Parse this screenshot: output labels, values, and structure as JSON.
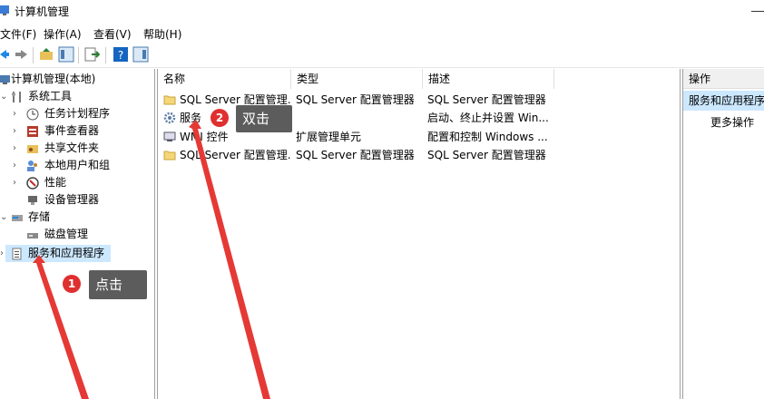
{
  "window": {
    "title": "计算机管理"
  },
  "menu": {
    "file": "文件(F)",
    "action": "操作(A)",
    "view": "查看(V)",
    "help": "帮助(H)"
  },
  "tree": {
    "root": "计算机管理(本地)",
    "system_tools": "系统工具",
    "task_scheduler": "任务计划程序",
    "event_viewer": "事件查看器",
    "shared_folders": "共享文件夹",
    "local_users": "本地用户和组",
    "performance": "性能",
    "device_manager": "设备管理器",
    "storage": "存储",
    "disk_management": "磁盘管理",
    "services_apps": "服务和应用程序"
  },
  "list": {
    "columns": {
      "name": "名称",
      "type": "类型",
      "desc": "描述"
    },
    "rows": [
      {
        "name": "SQL Server 配置管理...",
        "type": "SQL Server 配置管理器",
        "desc": "SQL Server 配置管理器"
      },
      {
        "name": "服务",
        "type": "",
        "desc": "启动、终止并设置 Win..."
      },
      {
        "name": "WMI 控件",
        "type": "扩展管理单元",
        "desc": "配置和控制 Windows ..."
      },
      {
        "name": "SQL Server 配置管理...",
        "type": "SQL Server 配置管理器",
        "desc": "SQL Server 配置管理器"
      }
    ]
  },
  "actions": {
    "header": "操作",
    "selected": "服务和应用程序",
    "more": "更多操作"
  },
  "annotations": {
    "step1": {
      "number": "1",
      "label": "点击"
    },
    "step2": {
      "number": "2",
      "label": "双击"
    }
  },
  "colors": {
    "selection": "#cce8ff",
    "arrow": "#e53935",
    "callout_bg": "#5c5c5c",
    "badge": "#e02f2f"
  }
}
